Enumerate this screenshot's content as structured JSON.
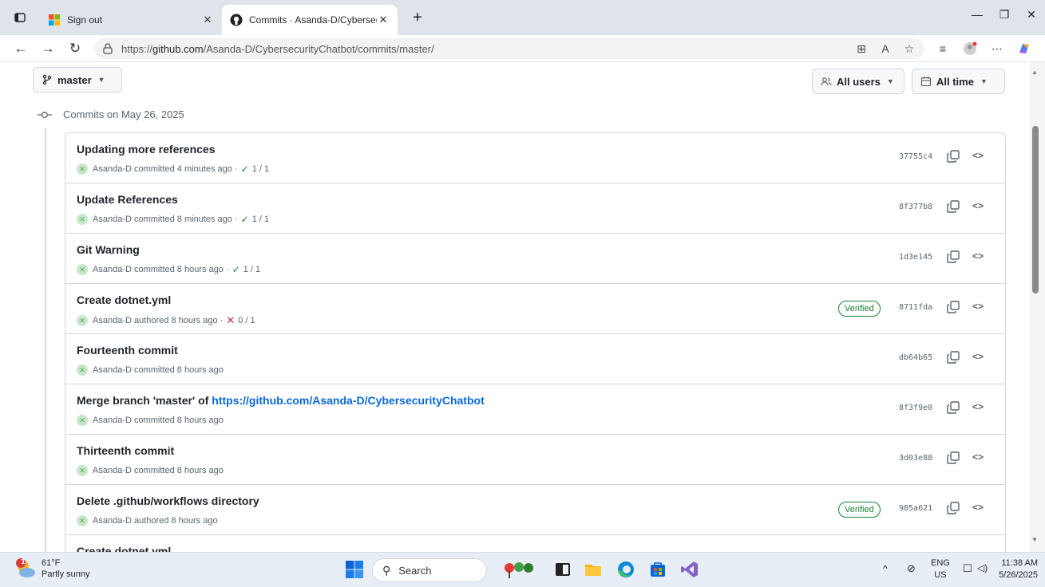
{
  "browser": {
    "tabs": [
      {
        "label": "Sign out",
        "active": false
      },
      {
        "label": "Commits · Asanda-D/Cybersecurit",
        "active": true
      }
    ],
    "url_prefix": "https://",
    "url_host": "github.com",
    "url_path": "/Asanda-D/CybersecurityChatbot/commits/master/",
    "new_tab": "+"
  },
  "filters": {
    "branch": "master",
    "users": "All users",
    "time": "All time"
  },
  "group": {
    "date_label": "Commits on May 26, 2025"
  },
  "commits": [
    {
      "title": "Updating more references",
      "title_link": "",
      "author": "Asanda-D",
      "action": "committed",
      "time": "4 minutes ago",
      "status": "check",
      "checks": "1 / 1",
      "verified": "",
      "sha": "37755c4"
    },
    {
      "title": "Update References",
      "title_link": "",
      "author": "Asanda-D",
      "action": "committed",
      "time": "8 minutes ago",
      "status": "check",
      "checks": "1 / 1",
      "verified": "",
      "sha": "8f377b8"
    },
    {
      "title": "Git Warning",
      "title_link": "",
      "author": "Asanda-D",
      "action": "committed",
      "time": "8 hours ago",
      "status": "check",
      "checks": "1 / 1",
      "verified": "",
      "sha": "1d3e145"
    },
    {
      "title": "Create dotnet.yml",
      "title_link": "",
      "author": "Asanda-D",
      "action": "authored",
      "time": "8 hours ago",
      "status": "cross",
      "checks": "0 / 1",
      "verified": "Verified",
      "sha": "8711fda"
    },
    {
      "title": "Fourteenth commit",
      "title_link": "",
      "author": "Asanda-D",
      "action": "committed",
      "time": "8 hours ago",
      "status": "",
      "checks": "",
      "verified": "",
      "sha": "db64b65"
    },
    {
      "title": "Merge branch 'master' of ",
      "title_link": "https://github.com/Asanda-D/CybersecurityChatbot",
      "author": "Asanda-D",
      "action": "committed",
      "time": "8 hours ago",
      "status": "",
      "checks": "",
      "verified": "",
      "sha": "8f3f9e0"
    },
    {
      "title": "Thirteenth commit",
      "title_link": "",
      "author": "Asanda-D",
      "action": "committed",
      "time": "8 hours ago",
      "status": "",
      "checks": "",
      "verified": "",
      "sha": "3d03e88"
    },
    {
      "title": "Delete .github/workflows directory",
      "title_link": "",
      "author": "Asanda-D",
      "action": "authored",
      "time": "8 hours ago",
      "status": "",
      "checks": "",
      "verified": "Verified",
      "sha": "985a621"
    },
    {
      "title": "Create dotnet.yml",
      "title_link": "",
      "author": "",
      "action": "",
      "time": "",
      "status": "",
      "checks": "",
      "verified": "",
      "sha": ""
    }
  ],
  "taskbar": {
    "weather_temp": "61°F",
    "weather_desc": "Partly sunny",
    "weather_badge": "1",
    "search_placeholder": "Search",
    "lang_top": "ENG",
    "lang_bottom": "US",
    "time": "11:38 AM",
    "date": "5/26/2025"
  },
  "colors": {
    "accent": "#0969da",
    "success": "#1a7f37",
    "danger": "#d1242f"
  }
}
